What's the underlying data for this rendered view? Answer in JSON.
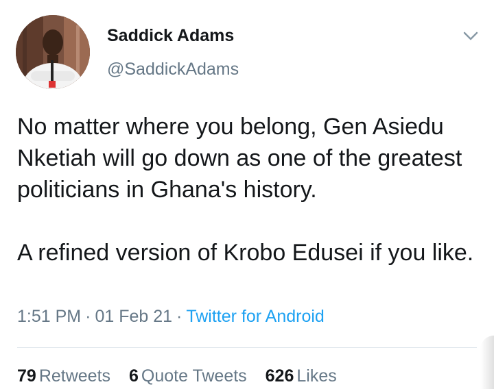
{
  "author": {
    "name": "Saddick Adams",
    "handle": "@SaddickAdams"
  },
  "tweet": {
    "paragraphs": [
      "No matter where you belong, Gen Asiedu Nketiah will go down as one of the greatest politicians in Ghana's history.",
      "A refined version of Krobo Edusei if you like."
    ],
    "time": "1:51 PM",
    "date": "01 Feb 21",
    "source": "Twitter for Android"
  },
  "stats": {
    "retweets_count": "79",
    "retweets_label": "Retweets",
    "quotes_count": "6",
    "quotes_label": "Quote Tweets",
    "likes_count": "626",
    "likes_label": "Likes"
  },
  "colors": {
    "link": "#1da1f2",
    "secondary_text": "#657786",
    "primary_text": "#14171a"
  },
  "icons": {
    "menu": "chevron-down-icon"
  }
}
